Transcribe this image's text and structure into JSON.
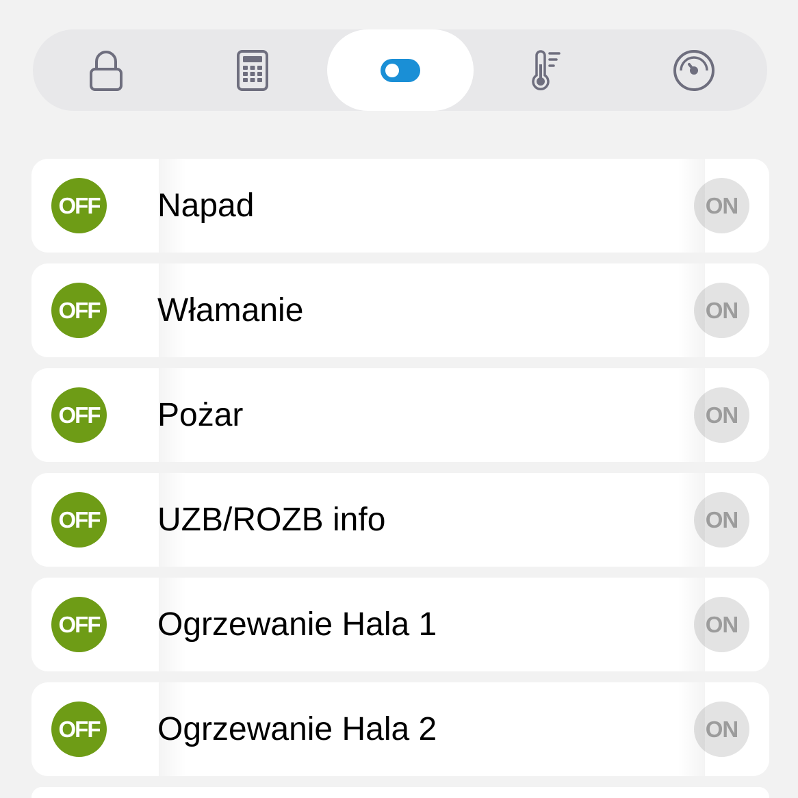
{
  "colors": {
    "background": "#f2f2f2",
    "tabbar_background": "#e8e8ea",
    "tab_active_background": "#ffffff",
    "icon_gray": "#6e6e7e",
    "toggle_accent": "#1a8fd6",
    "off_button": "#6e9c16",
    "on_button": "#e3e3e3",
    "on_button_text": "#9c9c9c"
  },
  "tabs": [
    {
      "icon": "lock-icon",
      "active": false
    },
    {
      "icon": "calculator-icon",
      "active": false
    },
    {
      "icon": "toggle-icon",
      "active": true
    },
    {
      "icon": "thermometer-icon",
      "active": false
    },
    {
      "icon": "gauge-icon",
      "active": false
    }
  ],
  "list": {
    "items": [
      {
        "label": "Napad",
        "off_label": "OFF",
        "on_label": "ON"
      },
      {
        "label": "Włamanie",
        "off_label": "OFF",
        "on_label": "ON"
      },
      {
        "label": "Pożar",
        "off_label": "OFF",
        "on_label": "ON"
      },
      {
        "label": "UZB/ROZB info",
        "off_label": "OFF",
        "on_label": "ON"
      },
      {
        "label": "Ogrzewanie Hala 1",
        "off_label": "OFF",
        "on_label": "ON"
      },
      {
        "label": "Ogrzewanie Hala 2",
        "off_label": "OFF",
        "on_label": "ON"
      }
    ]
  }
}
